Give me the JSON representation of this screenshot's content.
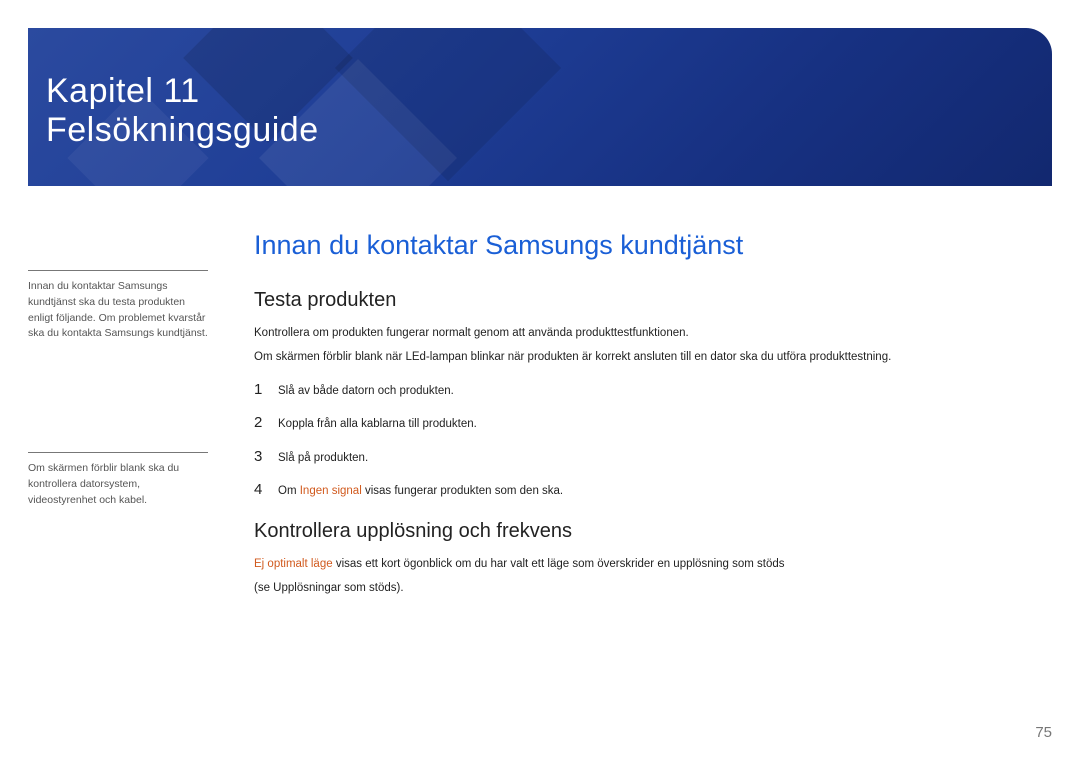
{
  "banner": {
    "chapter": "Kapitel 11",
    "title": "Felsökningsguide"
  },
  "sidebar": {
    "note1": "Innan du kontaktar Samsungs kundtjänst ska du testa produkten enligt följande. Om problemet kvarstår ska du kontakta Samsungs kundtjänst.",
    "note2": "Om skärmen förblir blank ska du kontrollera datorsystem, videostyrenhet och kabel."
  },
  "content": {
    "heading": "Innan du kontaktar Samsungs kundtjänst",
    "section1": {
      "title": "Testa produkten",
      "p1": "Kontrollera om produkten fungerar normalt genom att använda produkttestfunktionen.",
      "p2": "Om skärmen förblir blank när LEd-lampan blinkar när produkten är korrekt ansluten till en dator ska du utföra produkttestning.",
      "steps": [
        {
          "num": "1",
          "text": "Slå av både datorn och produkten."
        },
        {
          "num": "2",
          "text": "Koppla från alla kablarna till produkten."
        },
        {
          "num": "3",
          "text": "Slå på produkten."
        },
        {
          "num": "4",
          "prefix": "Om ",
          "accent": "Ingen signal",
          "suffix": " visas fungerar produkten som den ska."
        }
      ]
    },
    "section2": {
      "title": "Kontrollera upplösning och frekvens",
      "accent": "Ej optimalt läge",
      "p_suffix": " visas ett kort ögonblick om du har valt ett läge som överskrider en upplösning som stöds",
      "p2": "(se Upplösningar som stöds)."
    }
  },
  "page_number": "75"
}
